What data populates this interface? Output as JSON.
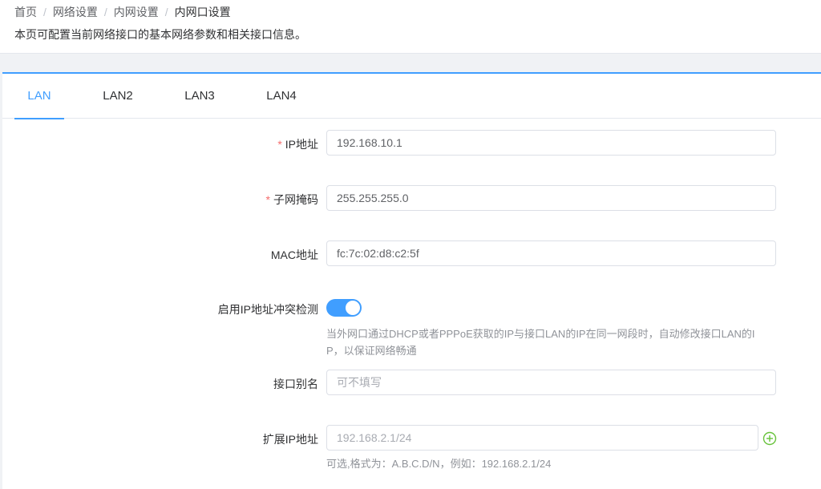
{
  "breadcrumb": {
    "items": [
      "首页",
      "网络设置",
      "内网设置",
      "内网口设置"
    ],
    "separator": "/"
  },
  "description": "本页可配置当前网络接口的基本网络参数和相关接口信息。",
  "tabs": [
    {
      "label": "LAN",
      "active": true
    },
    {
      "label": "LAN2",
      "active": false
    },
    {
      "label": "LAN3",
      "active": false
    },
    {
      "label": "LAN4",
      "active": false
    }
  ],
  "form": {
    "required_mark": "*",
    "ip": {
      "label": "IP地址",
      "value": "192.168.10.1"
    },
    "mask": {
      "label": "子网掩码",
      "value": "255.255.255.0"
    },
    "mac": {
      "label": "MAC地址",
      "value": "fc:7c:02:d8:c2:5f"
    },
    "conflict": {
      "label": "启用IP地址冲突检测",
      "enabled": true,
      "hint_line1": "当外网口通过DHCP或者PPPoE获取的IP与接口LAN的IP在同一网段时，自动修改接口LAN的I",
      "hint_line2": "P，以保证网络畅通"
    },
    "alias": {
      "label": "接口别名",
      "placeholder": "可不填写"
    },
    "ext_ip": {
      "label": "扩展IP地址",
      "placeholder": "192.168.2.1/24",
      "hint": "可选,格式为：A.B.C.D/N，例如：192.168.2.1/24"
    }
  },
  "icons": {
    "add": "plus-circle-icon"
  },
  "colors": {
    "accent": "#409eff",
    "add_icon": "#67c23a",
    "required": "#f56c6c"
  }
}
